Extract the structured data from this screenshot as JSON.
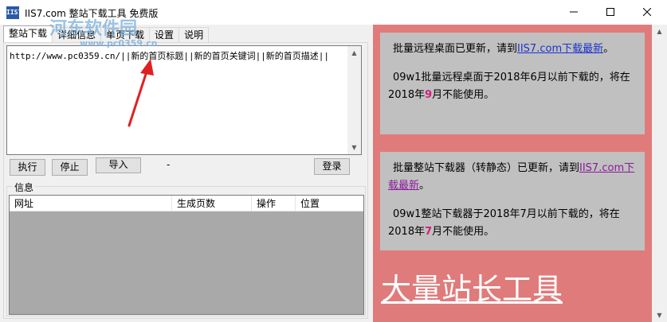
{
  "window": {
    "title": "IIS7.com 整站下载工具 免费版",
    "icon_text": "IIS7",
    "minimize_icon": "minimize-icon",
    "maximize_icon": "maximize-icon",
    "close_icon": "close-icon"
  },
  "tabs": [
    "整站下载",
    "详细信息",
    "单页下载",
    "设置",
    "说明"
  ],
  "active_tab": 0,
  "url_input": {
    "value": "http://www.pc0359.cn/||新的首页标题||新的首页关键词||新的首页描述||"
  },
  "buttons": {
    "run": "执行",
    "stop": "停止",
    "import": "导入",
    "login": "登录"
  },
  "status_dash": "-",
  "info": {
    "label": "信息",
    "columns": [
      "网址",
      "生成页数",
      "操作",
      "位置"
    ]
  },
  "watermark": {
    "main": "河东软件园",
    "sub": "www.pc0359.cn"
  },
  "notices": [
    {
      "prefix": "批量远程桌面已更新，请到",
      "link": "IIS7.com下载最新",
      "suffix": "。",
      "detail_prefix": "09w1批量远程桌面于2018年6月以前下载的，将在2018年",
      "highlight": "9",
      "detail_suffix": "月不能使用。"
    },
    {
      "prefix": "批量整站下载器（转静态）已更新，请到",
      "link": "IIS7.com下载最新",
      "suffix": "。",
      "detail_prefix": "09w1整站下载器于2018年7月以前下载的，将在2018年",
      "highlight": "7",
      "detail_suffix": "月不能使用。"
    }
  ],
  "big_title": "大量站长工具",
  "colors": {
    "right_panel_bg": "#e07b7b",
    "notice_bg": "#c0c0c0",
    "link_blue": "#1a33cc",
    "link_visited": "#8a1a9a",
    "highlight": "#d61f7a",
    "arrow": "#e02020",
    "list_bg": "#a9a9a9"
  }
}
